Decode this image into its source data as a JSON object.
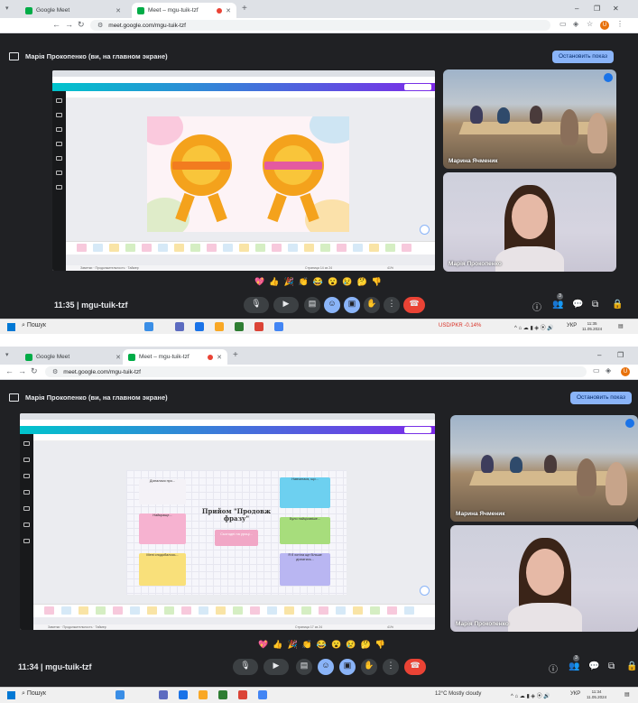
{
  "screenshots": [
    {
      "browser": {
        "tabs": [
          {
            "label": "Google Meet",
            "active": false
          },
          {
            "label": "Meet – mgu-tuik-tzf",
            "active": true
          }
        ],
        "url": "meet.google.com/mgu-tuik-tzf"
      },
      "meet_header": {
        "presenting_text": "Марія Прокопенко (ви, на главном экране)",
        "stop_button": "Остановить показ"
      },
      "presentation": {
        "page_counter": "Страница 14 из 24",
        "zoom": "41%",
        "bottom_tools": [
          "Заметки",
          "Продолжительность",
          "Таймер"
        ]
      },
      "participants": [
        {
          "name": "Марина Ячменик",
          "video": "classroom"
        },
        {
          "name": "Марія Прокопенко",
          "video": "self"
        }
      ],
      "meeting": {
        "time": "11:35",
        "code": "mgu-tuik-tzf"
      },
      "reactions": [
        "💖",
        "👍",
        "🎉",
        "👏",
        "😂",
        "😮",
        "😢",
        "🤔",
        "👎"
      ],
      "participant_count": "3",
      "taskbar": {
        "search": "Пошук",
        "tray_item": "USD/PKR -0.14%",
        "lang": "УКР",
        "time": "11:35",
        "date": "11.05.2024"
      }
    },
    {
      "browser": {
        "tabs": [
          {
            "label": "Google Meet",
            "active": false
          },
          {
            "label": "Meet – mgu-tuik-tzf",
            "active": true
          }
        ],
        "url": "meet.google.com/mgu-tuik-tzf"
      },
      "meet_header": {
        "presenting_text": "Марія Прокопенко (ви, на главном экране)",
        "stop_button": "Остановить показ"
      },
      "presentation": {
        "page_counter": "Страница 17 из 24",
        "zoom": "41%",
        "bottom_tools": [
          "Заметки",
          "Продолжительность",
          "Таймер"
        ],
        "slide_title": "Прийом \"Продовж фразу\"",
        "slide_subtitle": "Сьогодні на уроці...",
        "notes_left": [
          "Дізналася про...",
          "Найкраще...",
          "Мені сподобалось..."
        ],
        "notes_right": [
          "Навчилася, що...",
          "Було найцікавіше...",
          "Я б хотіла ще більше дізнатись..."
        ]
      },
      "participants": [
        {
          "name": "Марина Ячменик",
          "video": "classroom"
        },
        {
          "name": "Марія Прокопенко",
          "video": "self"
        }
      ],
      "meeting": {
        "time": "11:34",
        "code": "mgu-tuik-tzf"
      },
      "reactions": [
        "💖",
        "👍",
        "🎉",
        "👏",
        "😂",
        "😮",
        "😢",
        "🤔",
        "👎"
      ],
      "participant_count": "3",
      "taskbar": {
        "search": "Пошук",
        "tray_item": "12°C Mostly cloudy",
        "lang": "УКР",
        "time": "11:34",
        "date": "11.05.2024"
      }
    }
  ],
  "colors": {
    "meet_bg": "#202124",
    "accent_blue": "#8ab4f8",
    "end_call_red": "#ea4335",
    "canva_teal": "#00c4cc",
    "canva_purple": "#7d2ae8"
  }
}
